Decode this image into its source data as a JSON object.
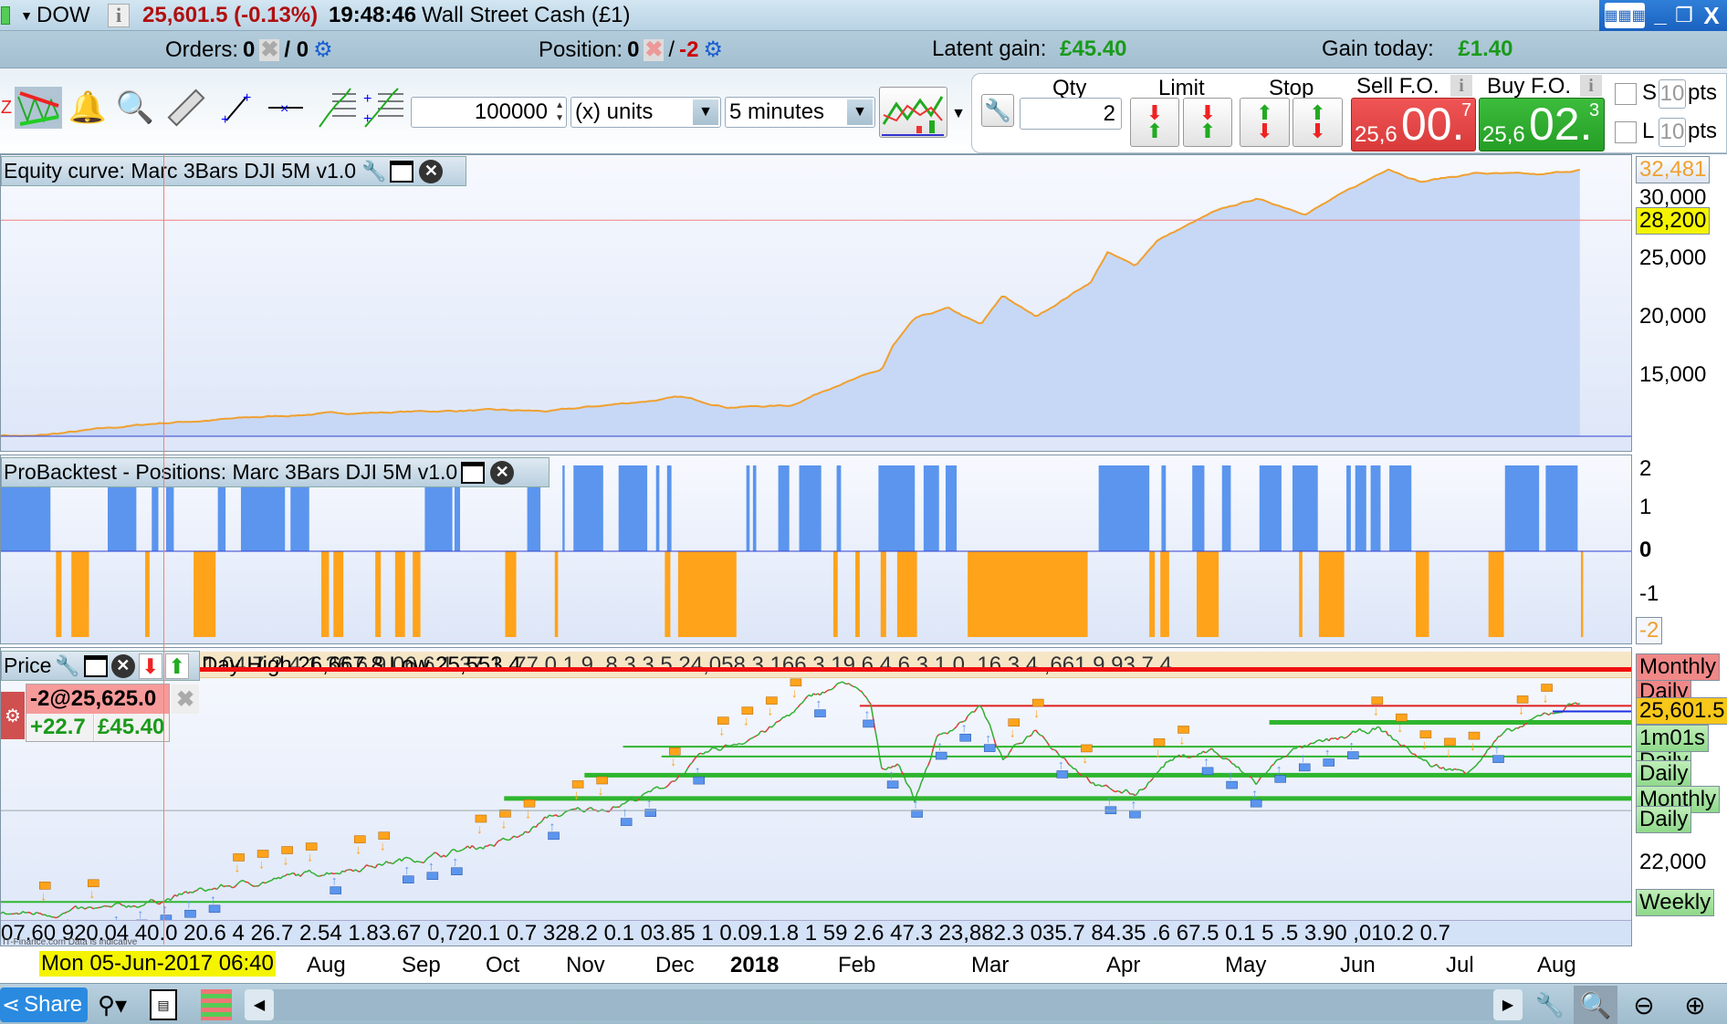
{
  "titlebar": {
    "instrument": "DOW",
    "price_change": "25,601.5 (-0.13%)",
    "time": "19:48:46",
    "market_name": "Wall Street Cash (£1)"
  },
  "infobar": {
    "orders_label": "Orders:",
    "orders_value": "0",
    "orders_pending": "/ 0",
    "position_label": "Position:",
    "position_value": "0",
    "position_sep": "/",
    "position_open": "-2",
    "latent_label": "Latent gain:",
    "latent_value": "£45.40",
    "gain_today_label": "Gain today:",
    "gain_today_value": "£1.40"
  },
  "toolbar": {
    "quantity_value": "100000",
    "units_select": "(x) units",
    "timeframe_select": "5 minutes",
    "qty_label": "Qty",
    "qty_value": "2",
    "limit_label": "Limit",
    "stop_label": "Stop",
    "sell_label": "Sell F.O.",
    "buy_label": "Buy F.O.",
    "sell_price": {
      "prefix": "25,6",
      "big": "00.",
      "sup": "7"
    },
    "buy_price": {
      "prefix": "25,6",
      "big": "02.",
      "sup": "3"
    },
    "stop_s_label": "S",
    "stop_s_value": "10",
    "stop_l_label": "L",
    "stop_l_value": "10",
    "pts_label": "pts"
  },
  "equity_panel": {
    "title": "Equity curve: Marc 3Bars DJI 5M v1.0",
    "last_value": "32,481",
    "cursor_value": "28,200",
    "ticks": [
      "30,000",
      "25,000",
      "20,000",
      "15,000"
    ]
  },
  "positions_panel": {
    "title": "ProBacktest - Positions: Marc 3Bars DJI 5M v1.0",
    "ticks": [
      "2",
      "1",
      "0",
      "-1"
    ],
    "last_value": "-2"
  },
  "price_panel": {
    "title": "Price",
    "day_range_text": "Day High 26,667.8 Low 25,553.4",
    "strip_values": "1.04.7 2 4.1 36.6 9 06.6 1 37.1 .77.0 1.9 .8 3 3.5 24,058.3 166.3 19.6 4 6.3 1.0 .16 3.4 ,661.9 93.7 4",
    "position_qty": "-2@25,625.0",
    "position_points": "+22.7",
    "position_gain": "£45.40",
    "bottom_values": "07.60 920.04 40.0 20.6 4 26.7 2.54 1.83.67 0,720.1 0.7 328.2 0.1 03.85 1 0.09.1.8 1 59 2.6 47.3 23,882.3 035.7 84.35 .6 67.5 0.1 5 .5 3.90 ,010.2 0.7",
    "watermark": "IT-Finance.com Data is indicative",
    "tags": {
      "monthly_top": "Monthly",
      "daily_hidden": "Daily",
      "current_price": "25,601.5",
      "countdown": "1m01s",
      "daily_1": "Daily",
      "monthly": "Monthly",
      "daily_2": "Daily",
      "tick_22000": "22,000",
      "weekly": "Weekly"
    }
  },
  "date_axis": {
    "cursor_date": "Mon 05-Jun-2017 06:40",
    "labels": [
      "Aug",
      "Sep",
      "Oct",
      "Nov",
      "Dec",
      "2018",
      "Feb",
      "Mar",
      "Apr",
      "May",
      "Jun",
      "Jul",
      "Aug"
    ]
  },
  "bottombar": {
    "share_label": "Share"
  },
  "colors": {
    "up": "#2fae2f",
    "down": "#e03a3a",
    "equity_fill": "#c7d8f6",
    "equity_line": "#f0a030",
    "long": "#5b95ee",
    "short": "#ffa31a"
  },
  "chart_data": [
    {
      "type": "area",
      "title": "Equity curve: Marc 3Bars DJI 5M v1.0",
      "x_unit": "bar index (0-1435)",
      "ylim": [
        8500,
        33500
      ],
      "points": [
        [
          0,
          10000
        ],
        [
          30,
          9900
        ],
        [
          143,
          11000
        ],
        [
          287,
          11800
        ],
        [
          430,
          12100
        ],
        [
          500,
          12000
        ],
        [
          617,
          13200
        ],
        [
          660,
          12400
        ],
        [
          717,
          12500
        ],
        [
          760,
          14300
        ],
        [
          800,
          15500
        ],
        [
          810,
          17500
        ],
        [
          830,
          19800
        ],
        [
          860,
          20700
        ],
        [
          890,
          19300
        ],
        [
          910,
          21800
        ],
        [
          940,
          20000
        ],
        [
          990,
          23000
        ],
        [
          1005,
          25500
        ],
        [
          1030,
          24300
        ],
        [
          1050,
          26500
        ],
        [
          1100,
          28800
        ],
        [
          1140,
          30000
        ],
        [
          1185,
          28800
        ],
        [
          1240,
          31500
        ],
        [
          1260,
          32600
        ],
        [
          1290,
          31500
        ],
        [
          1340,
          32200
        ],
        [
          1400,
          32000
        ],
        [
          1435,
          32481
        ]
      ]
    },
    {
      "type": "bar",
      "title": "ProBacktest - Positions",
      "x_unit": "bar index (0-1435)",
      "ylim": [
        -2,
        2
      ],
      "long_periods": [
        [
          0,
          45
        ],
        [
          97,
          123
        ],
        [
          137,
          143
        ],
        [
          150,
          157
        ],
        [
          197,
          204
        ],
        [
          218,
          258
        ],
        [
          263,
          280
        ],
        [
          385,
          410
        ],
        [
          412,
          417
        ],
        [
          478,
          490
        ],
        [
          510,
          512
        ],
        [
          520,
          547
        ],
        [
          561,
          587
        ],
        [
          595,
          598
        ],
        [
          605,
          609
        ],
        [
          677,
          680
        ],
        [
          683,
          686
        ],
        [
          706,
          716
        ],
        [
          725,
          745
        ],
        [
          759,
          763
        ],
        [
          797,
          830
        ],
        [
          838,
          852
        ],
        [
          858,
          868
        ],
        [
          997,
          1043
        ],
        [
          1054,
          1058
        ],
        [
          1082,
          1093
        ],
        [
          1109,
          1117
        ],
        [
          1143,
          1163
        ],
        [
          1173,
          1196
        ],
        [
          1222,
          1226
        ],
        [
          1230,
          1240
        ],
        [
          1244,
          1253
        ],
        [
          1261,
          1281
        ],
        [
          1366,
          1397
        ],
        [
          1403,
          1432
        ]
      ],
      "short_periods": [
        [
          50,
          55
        ],
        [
          64,
          80
        ],
        [
          131,
          135
        ],
        [
          175,
          195
        ],
        [
          291,
          298
        ],
        [
          302,
          311
        ],
        [
          340,
          345
        ],
        [
          358,
          367
        ],
        [
          374,
          381
        ],
        [
          458,
          468
        ],
        [
          503,
          506
        ],
        [
          603,
          608
        ],
        [
          615,
          668
        ],
        [
          756,
          760
        ],
        [
          776,
          780
        ],
        [
          799,
          804
        ],
        [
          814,
          832
        ],
        [
          878,
          987
        ],
        [
          1043,
          1048
        ],
        [
          1053,
          1061
        ],
        [
          1086,
          1106
        ],
        [
          1179,
          1182
        ],
        [
          1197,
          1220
        ],
        [
          1285,
          1297
        ],
        [
          1351,
          1365
        ],
        [
          1435,
          1437
        ]
      ]
    },
    {
      "type": "line",
      "title": "Price",
      "x_unit": "bar index (0-1435)",
      "ylim": [
        20700,
        27400
      ],
      "points": [
        [
          0,
          20773
        ],
        [
          100,
          20900
        ],
        [
          200,
          21430
        ],
        [
          300,
          21820
        ],
        [
          400,
          22210
        ],
        [
          470,
          22600
        ],
        [
          500,
          23120
        ],
        [
          560,
          23380
        ],
        [
          600,
          23770
        ],
        [
          640,
          24560
        ],
        [
          700,
          25210
        ],
        [
          740,
          25990
        ],
        [
          770,
          26310
        ],
        [
          790,
          25730
        ],
        [
          800,
          24170
        ],
        [
          815,
          24430
        ],
        [
          830,
          23510
        ],
        [
          850,
          24950
        ],
        [
          890,
          25730
        ],
        [
          910,
          24430
        ],
        [
          940,
          25210
        ],
        [
          970,
          24430
        ],
        [
          1000,
          23770
        ],
        [
          1030,
          23640
        ],
        [
          1060,
          24430
        ],
        [
          1100,
          24690
        ],
        [
          1140,
          23900
        ],
        [
          1170,
          24690
        ],
        [
          1200,
          24820
        ],
        [
          1250,
          25210
        ],
        [
          1300,
          24300
        ],
        [
          1330,
          24170
        ],
        [
          1360,
          24950
        ],
        [
          1400,
          25470
        ],
        [
          1435,
          25860
        ]
      ],
      "levels": [
        {
          "price": 26668,
          "from": 0,
          "color": "red",
          "thick": true
        },
        {
          "price": 25734,
          "from": 780,
          "color": "red",
          "thick": false
        },
        {
          "price": 25342,
          "from": 1152,
          "color": "green",
          "thick": true
        },
        {
          "price": 24768,
          "from": 565,
          "color": "green",
          "thick": false
        },
        {
          "price": 24533,
          "from": 600,
          "color": "green",
          "thick": false
        },
        {
          "price": 24090,
          "from": 530,
          "color": "green",
          "thick": true
        },
        {
          "price": 23540,
          "from": 457,
          "color": "green",
          "thick": true
        },
        {
          "price": 21086,
          "from": 0,
          "color": "green",
          "thick": false
        }
      ]
    }
  ]
}
